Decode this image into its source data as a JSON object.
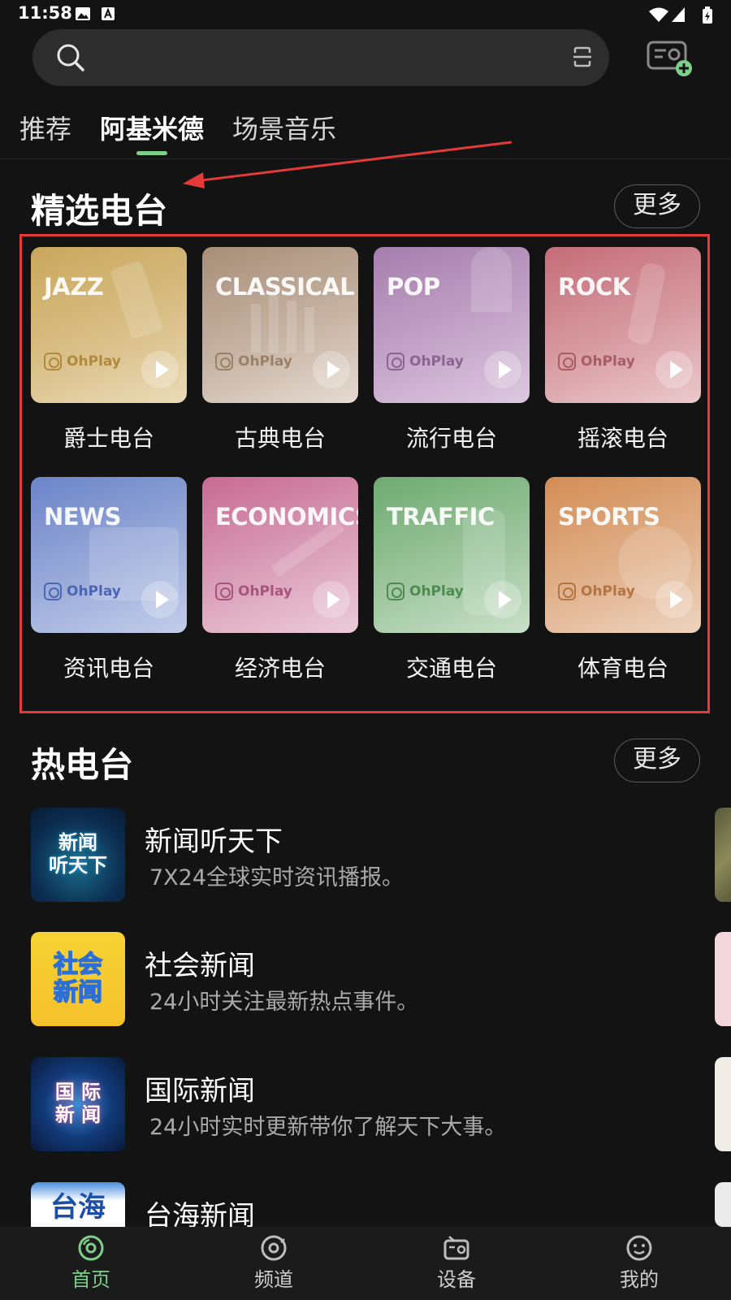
{
  "status_bar": {
    "time": "11:58"
  },
  "top_tabs": [
    {
      "label": "推荐"
    },
    {
      "label": "阿基米德"
    },
    {
      "label": "场景音乐"
    }
  ],
  "active_tab": "阿基米德",
  "featured": {
    "title": "精选电台",
    "more_label": "更多",
    "brand": "OhPlay",
    "stations": [
      {
        "category": "JAZZ",
        "name": "爵士电台",
        "accent": "#cdb06e"
      },
      {
        "category": "CLASSICAL",
        "name": "古典电台",
        "accent": "#b59c84"
      },
      {
        "category": "POP",
        "name": "流行电台",
        "accent": "#b38fb8"
      },
      {
        "category": "ROCK",
        "name": "摇滚电台",
        "accent": "#c97a84"
      },
      {
        "category": "NEWS",
        "name": "资讯电台",
        "accent": "#7d8fc9"
      },
      {
        "category": "ECONOMICS",
        "name": "经济电台",
        "accent": "#c9739a"
      },
      {
        "category": "TRAFFIC",
        "name": "交通电台",
        "accent": "#7fb37f"
      },
      {
        "category": "SPORTS",
        "name": "体育电台",
        "accent": "#d49865"
      }
    ]
  },
  "hot": {
    "title": "热电台",
    "more_label": "更多",
    "items": [
      {
        "title": "新闻听天下",
        "desc": "7X24全球实时资讯播报。",
        "thumb_text": "新闻\n听天下"
      },
      {
        "title": "社会新闻",
        "desc": "24小时关注最新热点事件。",
        "thumb_text": "社会\n新闻"
      },
      {
        "title": "国际新闻",
        "desc": "24小时实时更新带你了解天下大事。",
        "thumb_text": "国 际\n新 闻"
      },
      {
        "title": "台海新闻",
        "desc": "",
        "thumb_text": "台海"
      }
    ]
  },
  "bottom_nav": [
    {
      "label": "首页",
      "icon": "home-disc-icon"
    },
    {
      "label": "频道",
      "icon": "channel-disc-icon"
    },
    {
      "label": "设备",
      "icon": "device-radio-icon"
    },
    {
      "label": "我的",
      "icon": "profile-smile-icon"
    }
  ],
  "colors": {
    "accent_green": "#7ecf8a",
    "annotation_red": "#e43a3a",
    "background": "#131313"
  }
}
